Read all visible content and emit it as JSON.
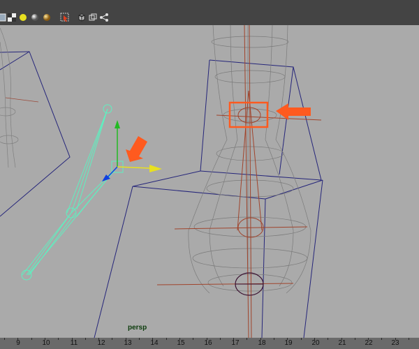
{
  "toolbar": {
    "icons": [
      "shading-icon",
      "checker-icon",
      "light-icon",
      "sphere-icon",
      "gold-sphere-icon",
      "select-icon",
      "cube-icon",
      "wire-cube-icon",
      "graph-icon"
    ]
  },
  "viewport": {
    "label": "persp",
    "background": "#aaaaaa",
    "joint_color": "#5ff0c0",
    "highlight_color": "#ff5a1f",
    "wire_color": "#25257a"
  },
  "ruler": {
    "ticks": [
      "9",
      "10",
      "11",
      "12",
      "13",
      "14",
      "15",
      "16",
      "17",
      "18",
      "19",
      "20",
      "21",
      "22",
      "23"
    ]
  }
}
